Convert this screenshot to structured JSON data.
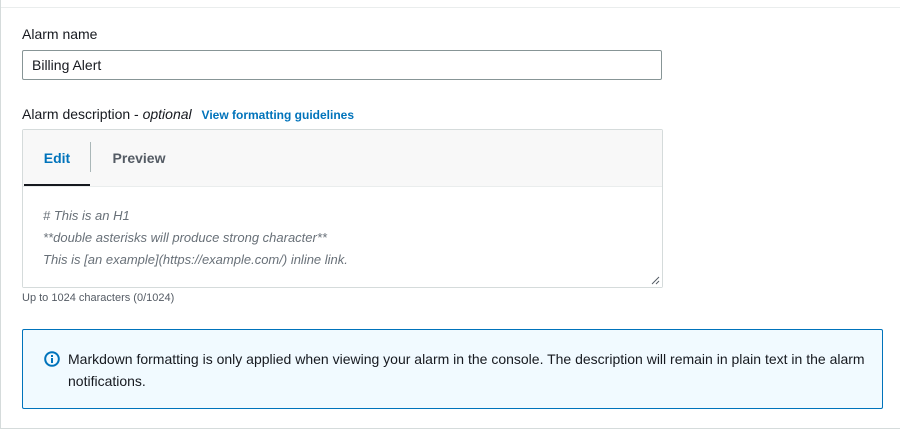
{
  "alarm_name": {
    "label": "Alarm name",
    "value": "Billing Alert"
  },
  "alarm_description": {
    "label": "Alarm description - ",
    "optional": "optional",
    "guidelines_link": "View formatting guidelines",
    "tabs": [
      {
        "label": "Edit",
        "selected": true
      },
      {
        "label": "Preview",
        "selected": false
      }
    ],
    "placeholder_lines": [
      "# This is an H1",
      "**double asterisks will produce strong character**",
      "This is [an example](https://example.com/) inline link."
    ],
    "char_count": "Up to 1024 characters (0/1024)"
  },
  "info_alert": {
    "icon": "info-icon",
    "text": "Markdown formatting is only applied when viewing your alarm in the console. The description will remain in plain text in the alarm notifications."
  },
  "colors": {
    "link": "#0073bb",
    "info_border": "#0073bb",
    "info_background": "#f1faff"
  }
}
